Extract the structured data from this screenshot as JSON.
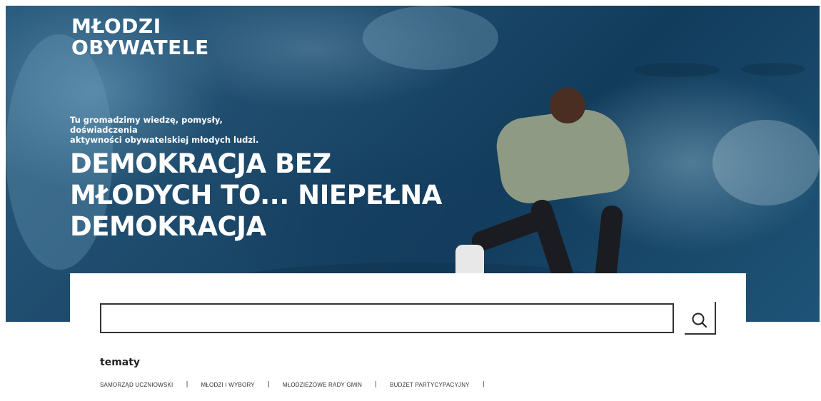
{
  "hero": {
    "logo_line1": "MŁODZI",
    "logo_line2": "OBYWATELE",
    "tagline_line1": "Tu gromadzimy wiedzę, pomysły, doświadczenia",
    "tagline_line2": "aktywności obywatelskiej młodych ludzi.",
    "headline_line1": "DEMOKRACJA BEZ",
    "headline_line2": "MŁODYCH TO... NIEPEŁNA",
    "headline_line3": "DEMOKRACJA"
  },
  "search": {
    "value": "",
    "placeholder": "",
    "button_icon": "search-icon"
  },
  "topics": {
    "title": "tematy",
    "items": [
      {
        "label": "SAMORZĄD UCZNIOWSKI"
      },
      {
        "label": "MŁODZI I WYBORY"
      },
      {
        "label": "MŁODZIEŻOWE RADY GMIN"
      },
      {
        "label": "BUDŻET PARTYCYPACYJNY"
      }
    ],
    "separator": "|"
  },
  "colors": {
    "hero_blue": "#1d4a6b",
    "text_light": "#ffffff",
    "border_dark": "#333333"
  }
}
